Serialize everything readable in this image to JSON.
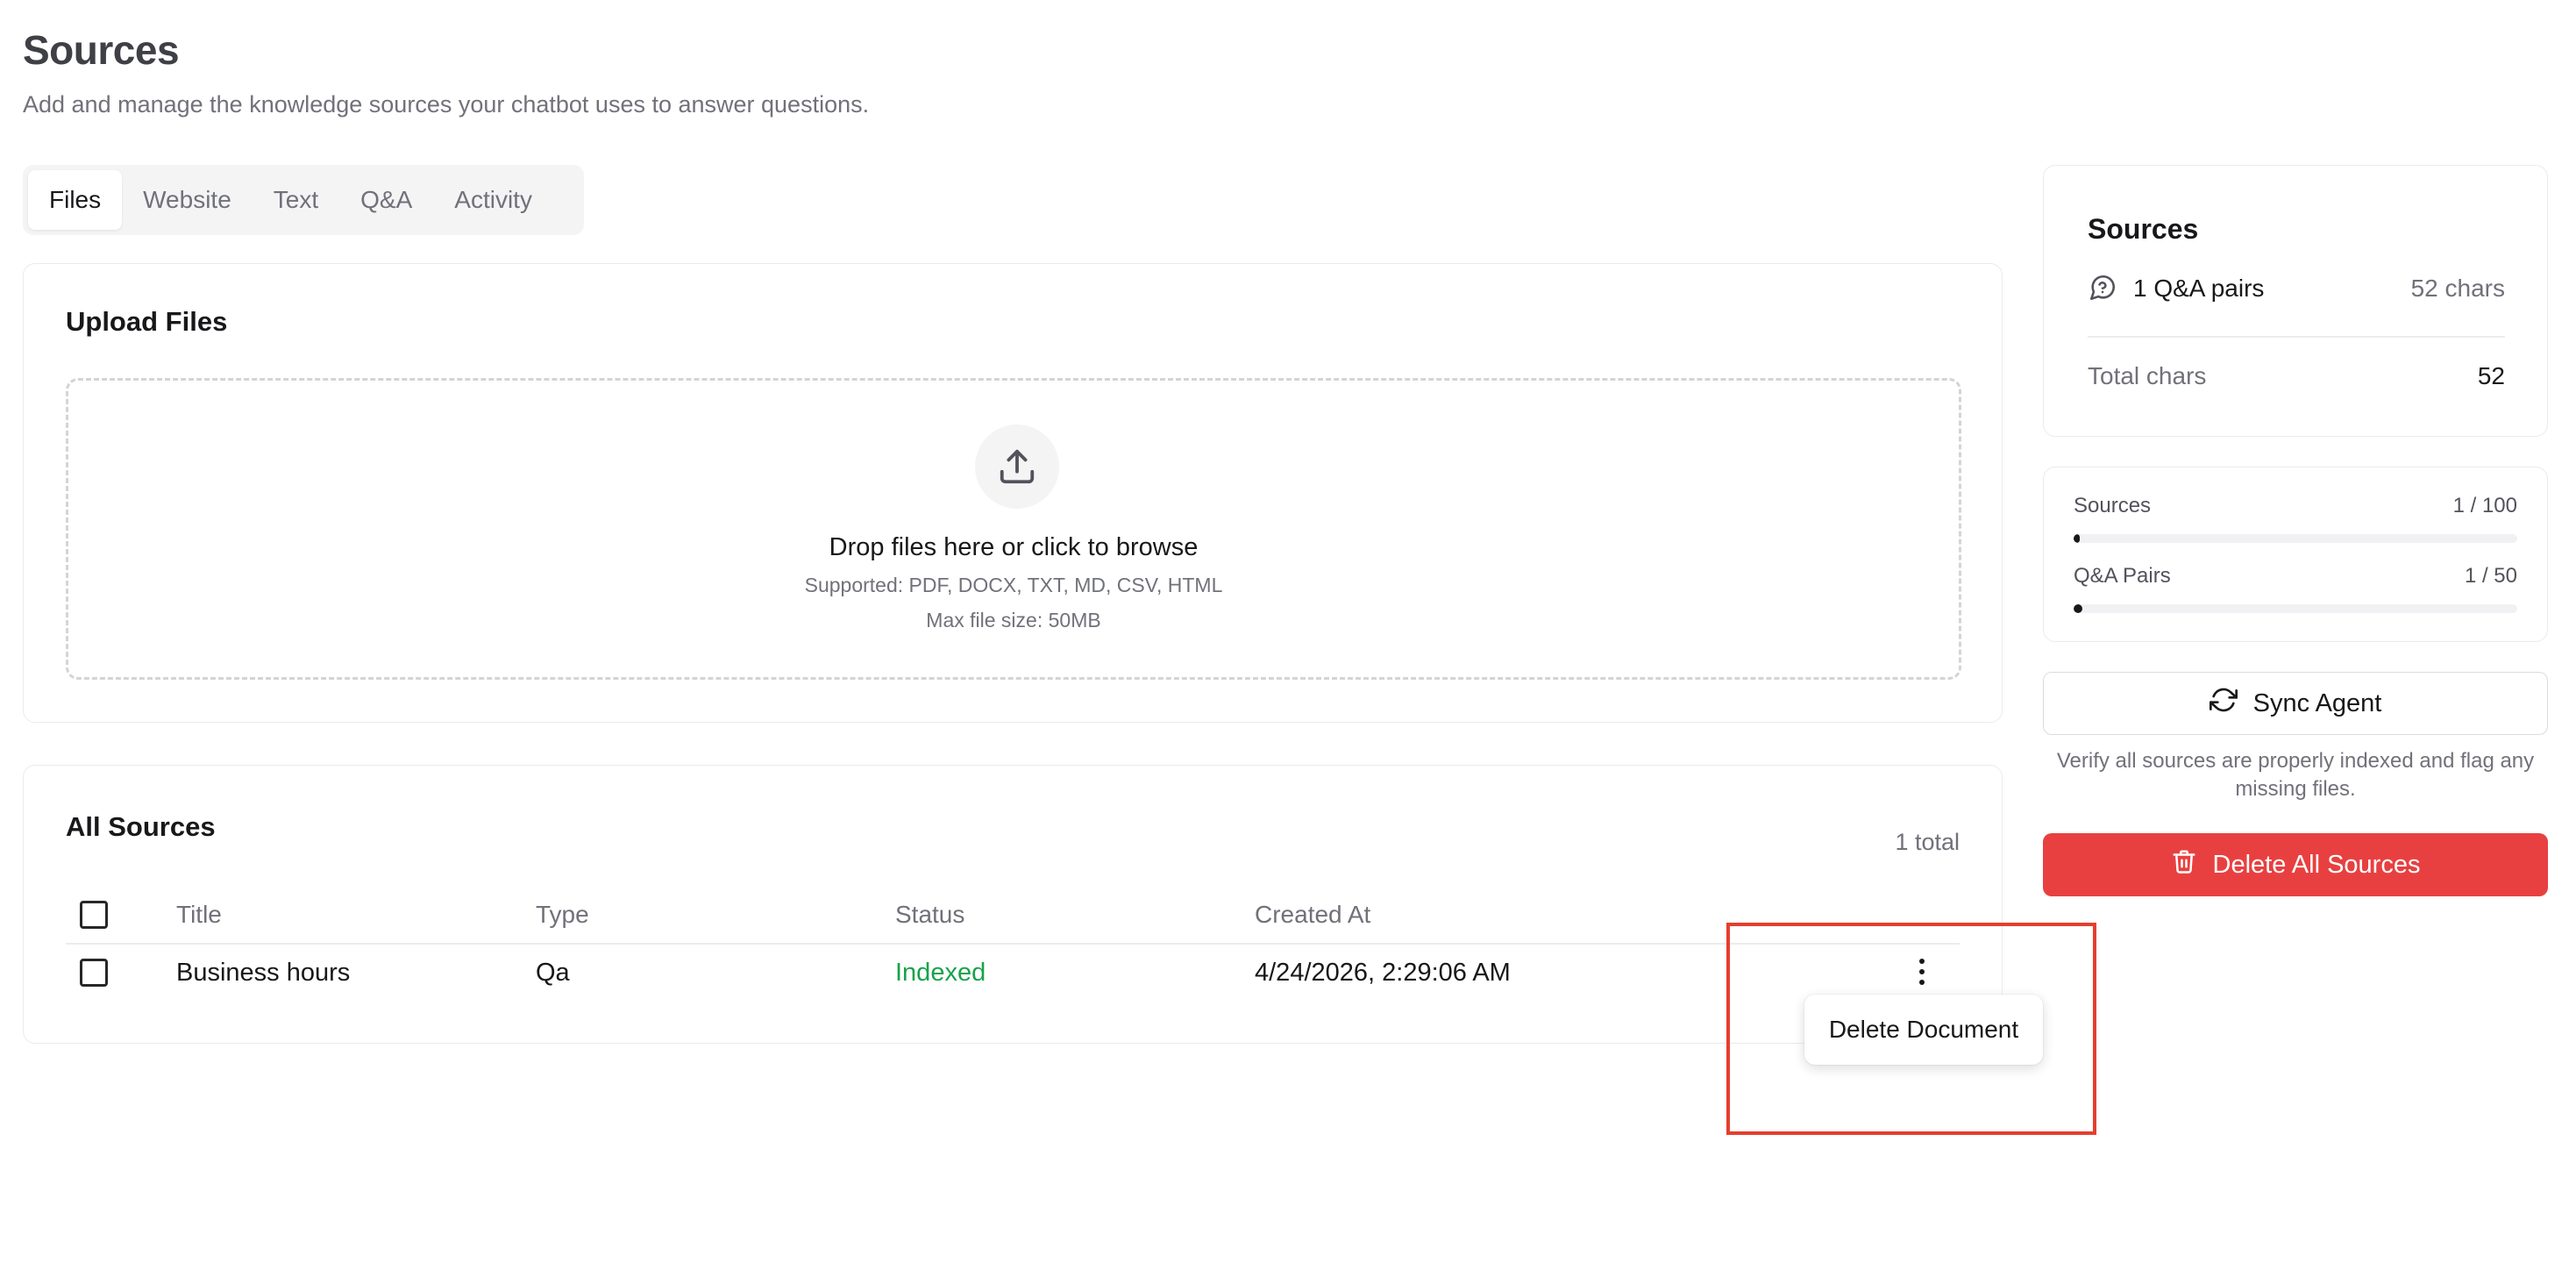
{
  "header": {
    "title": "Sources",
    "subtitle": "Add and manage the knowledge sources your chatbot uses to answer questions."
  },
  "tabs": [
    {
      "label": "Files",
      "active": true
    },
    {
      "label": "Website",
      "active": false
    },
    {
      "label": "Text",
      "active": false
    },
    {
      "label": "Q&A",
      "active": false
    },
    {
      "label": "Activity",
      "active": false
    }
  ],
  "upload": {
    "title": "Upload Files",
    "icon": "upload-icon",
    "drop_title": "Drop files here or click to browse",
    "supported": "Supported: PDF, DOCX, TXT, MD, CSV, HTML",
    "max_size": "Max file size: 50MB"
  },
  "sources_table": {
    "title": "All Sources",
    "total": "1 total",
    "columns": [
      "Title",
      "Type",
      "Status",
      "Created At"
    ],
    "rows": [
      {
        "title": "Business hours",
        "type": "Qa",
        "status": "Indexed",
        "created_at": "4/24/2026, 2:29:06 AM"
      }
    ],
    "row_menu": {
      "items": [
        "Delete Document"
      ]
    }
  },
  "summary": {
    "title": "Sources",
    "qa_label": "1 Q&A pairs",
    "qa_chars": "52 chars",
    "total_label": "Total chars",
    "total_value": "52"
  },
  "limits": {
    "sources": {
      "label": "Sources",
      "value": "1 / 100",
      "fraction": 0.01
    },
    "qa_pairs": {
      "label": "Q&A Pairs",
      "value": "1 / 50",
      "fraction": 0.02
    }
  },
  "actions": {
    "sync_label": "Sync Agent",
    "sync_note": "Verify all sources are properly indexed and flag any missing files.",
    "delete_all_label": "Delete All Sources"
  },
  "colors": {
    "danger": "#e84040",
    "success": "#16a34a",
    "highlight": "#e53e2e"
  }
}
